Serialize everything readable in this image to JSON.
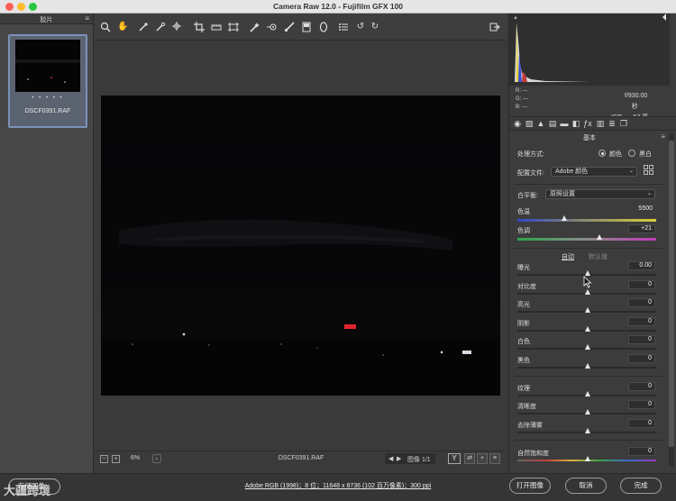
{
  "window": {
    "title": "Camera Raw 12.0 -  Fujifilm GFX 100"
  },
  "filmstrip": {
    "title": "胶片",
    "thumb_stars": "• • • • •",
    "thumb_name": "DSCF0391.RAF"
  },
  "toolbar": {
    "tools": [
      "zoom-icon",
      "hand-icon",
      "white-balance-icon",
      "color-sampler-icon",
      "targeted-adjustment-icon",
      "crop-icon",
      "straighten-icon",
      "transform-icon",
      "spot-removal-icon",
      "red-eye-icon",
      "adjustment-brush-icon",
      "graduated-filter-icon",
      "radial-filter-icon",
      "preferences-icon",
      "rotate-ccw-icon",
      "rotate-cw-icon",
      "export-icon"
    ]
  },
  "canvas_bar": {
    "minus": "−",
    "plus": "+",
    "zoom": "6%",
    "filename": "DSCF0391.RAF",
    "image_counter": "图像 1/1",
    "y_button": "Y"
  },
  "histogram": {
    "r_label": "R:",
    "g_label": "G:",
    "b_label": "B:",
    "r_val": "---",
    "g_val": "---",
    "b_val": "---",
    "aperture": "f/9",
    "shutter": "30.00 秒",
    "iso": "ISO 100",
    "focal": "63 毫米"
  },
  "basic": {
    "section_title": "基本",
    "process_label": "处理方式:",
    "process_color": "颜色",
    "process_bw": "黑白",
    "profile_label": "配置文件:",
    "profile_value": "Adobe 颜色",
    "wb_label": "白平衡:",
    "wb_value": "原照设置",
    "temp_label": "色温",
    "temp_value": "5500",
    "tint_label": "色调",
    "tint_value": "+21",
    "auto_link": "自动",
    "default_link": "默认值",
    "sliders": [
      {
        "label": "曝光",
        "value": "0.00"
      },
      {
        "label": "对比度",
        "value": "0"
      },
      {
        "label": "高光",
        "value": "0"
      },
      {
        "label": "阴影",
        "value": "0"
      },
      {
        "label": "白色",
        "value": "0"
      },
      {
        "label": "黑色",
        "value": "0"
      },
      {
        "label": "纹理",
        "value": "0"
      },
      {
        "label": "清晰度",
        "value": "0"
      },
      {
        "label": "去除薄雾",
        "value": "0"
      },
      {
        "label": "自然饱和度",
        "value": "0"
      }
    ]
  },
  "footer": {
    "save_label": "存储图像...",
    "info": "Adobe RGB (1998)；8 位；11648 x 8736 (102 百万像素)；300 ppi",
    "open_label": "打开图像",
    "cancel_label": "取消",
    "done_label": "完成",
    "watermark": "大疆跨境"
  }
}
